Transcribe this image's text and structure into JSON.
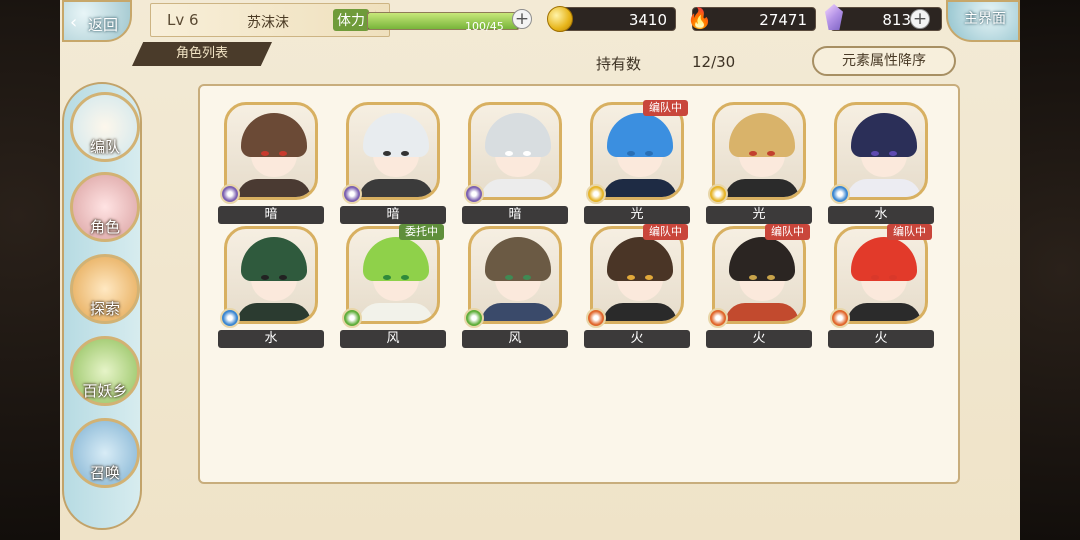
{
  "top": {
    "back_label": "返回",
    "home_label": "主界面",
    "level": "Lv 6",
    "player_name": "苏沫沫",
    "stamina_label": "体力",
    "stamina_text": "100/45",
    "stamina_level": 1.0,
    "coins": "3410",
    "soul_fire": "27471",
    "crystals": "813",
    "plus": "+"
  },
  "section": {
    "tab_label": "角色列表",
    "owned_label": "持有数",
    "owned_count": "12/30",
    "sort_label": "元素属性降序"
  },
  "nav": [
    {
      "label": "编队",
      "icon": "team-icon"
    },
    {
      "label": "角色",
      "icon": "character-icon"
    },
    {
      "label": "探索",
      "icon": "explore-icon"
    },
    {
      "label": "百妖乡",
      "icon": "village-icon"
    },
    {
      "label": "召唤",
      "icon": "summon-icon"
    }
  ],
  "characters": [
    {
      "element": "暗",
      "status": "",
      "hair": "#6b4a36",
      "eyes": "#c73a2d",
      "outfit": "#4a3a32",
      "badge": "#7a5fb0"
    },
    {
      "element": "暗",
      "status": "",
      "hair": "#e8ecef",
      "eyes": "#333333",
      "outfit": "#3b3b3b",
      "badge": "#7a5fb0"
    },
    {
      "element": "暗",
      "status": "",
      "hair": "#d8dde0",
      "eyes": "#ffffff",
      "outfit": "#ececec",
      "badge": "#7a5fb0"
    },
    {
      "element": "光",
      "status": "编队中",
      "hair": "#3b8fe0",
      "eyes": "#2a6fb5",
      "outfit": "#1e2b44",
      "badge": "#e6b428"
    },
    {
      "element": "光",
      "status": "",
      "hair": "#d9b36a",
      "eyes": "#c2402e",
      "outfit": "#2b2b2b",
      "badge": "#e6b428"
    },
    {
      "element": "水",
      "status": "",
      "hair": "#2b2f58",
      "eyes": "#5e4ab0",
      "outfit": "#ececf2",
      "badge": "#3a86d1"
    },
    {
      "element": "水",
      "status": "",
      "hair": "#2f5a3d",
      "eyes": "#222222",
      "outfit": "#2b3b30",
      "badge": "#3a86d1"
    },
    {
      "element": "风",
      "status": "委托中",
      "hair": "#8fd14a",
      "eyes": "#2f8a3b",
      "outfit": "#f2f2ea",
      "badge": "#5fae3a"
    },
    {
      "element": "风",
      "status": "",
      "hair": "#6b5a44",
      "eyes": "#3f8a54",
      "outfit": "#3a4a6a",
      "badge": "#5fae3a"
    },
    {
      "element": "火",
      "status": "编队中",
      "hair": "#4a3526",
      "eyes": "#e2a93a",
      "outfit": "#2a2a2a",
      "badge": "#e0662b"
    },
    {
      "element": "火",
      "status": "编队中",
      "hair": "#2b2522",
      "eyes": "#c8a34a",
      "outfit": "#c24a2e",
      "badge": "#e0662b"
    },
    {
      "element": "火",
      "status": "编队中",
      "hair": "#e23a2a",
      "eyes": "#d9382a",
      "outfit": "#2b2b2b",
      "badge": "#e0662b"
    }
  ]
}
